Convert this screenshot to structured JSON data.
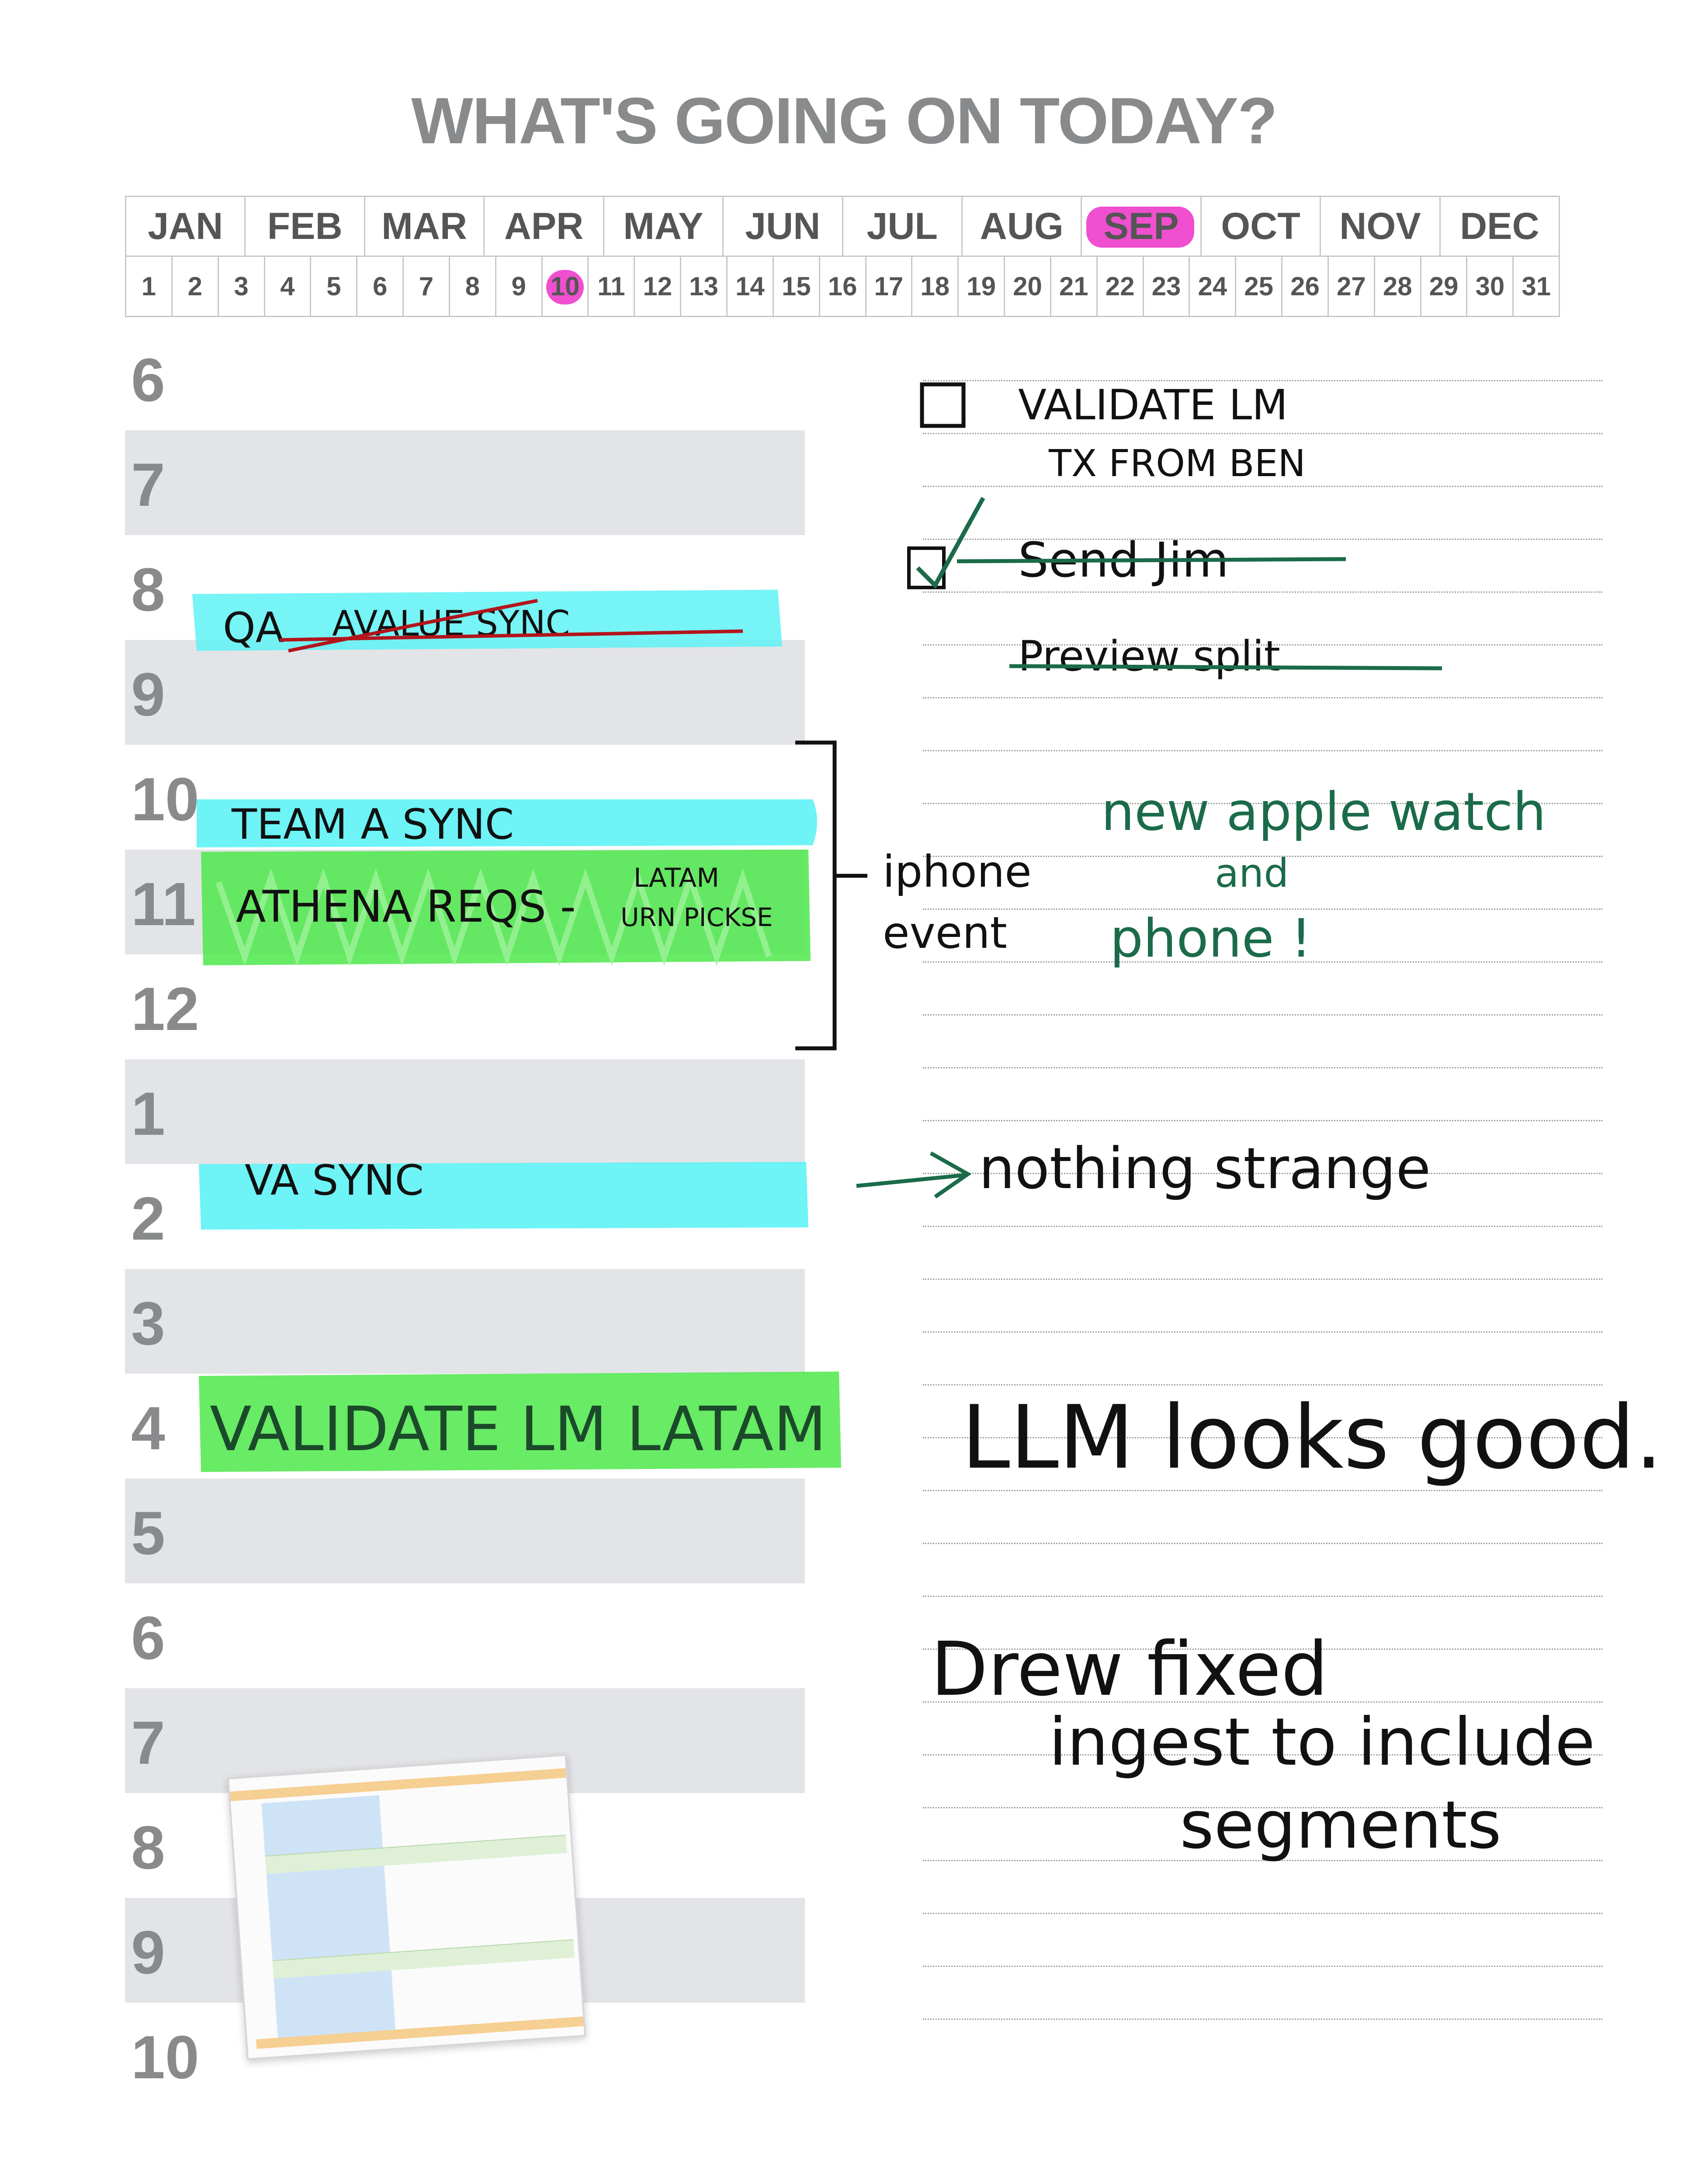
{
  "title": "WHAT'S GOING ON TODAY?",
  "months": [
    "JAN",
    "FEB",
    "MAR",
    "APR",
    "MAY",
    "JUN",
    "JUL",
    "AUG",
    "SEP",
    "OCT",
    "NOV",
    "DEC"
  ],
  "selected_month": "SEP",
  "days": [
    "1",
    "2",
    "3",
    "4",
    "5",
    "6",
    "7",
    "8",
    "9",
    "10",
    "11",
    "12",
    "13",
    "14",
    "15",
    "16",
    "17",
    "18",
    "19",
    "20",
    "21",
    "22",
    "23",
    "24",
    "25",
    "26",
    "27",
    "28",
    "29",
    "30",
    "31"
  ],
  "selected_day": "10",
  "hours": [
    "6",
    "7",
    "8",
    "9",
    "10",
    "11",
    "12",
    "1",
    "2",
    "3",
    "4",
    "5",
    "6",
    "7",
    "8",
    "9",
    "10"
  ],
  "colors": {
    "highlight_pink": "#f04fd0",
    "highlight_cyan": "#5ef2f5",
    "highlight_green": "#4ee84a",
    "ink_black": "#111111",
    "ink_green": "#1b6b4a",
    "ink_red": "#b3141c",
    "hour_band": "#e3e4e7"
  },
  "schedule": {
    "qa": {
      "text": "QA",
      "struck": "AVALUE SYNC"
    },
    "team_a": "TEAM A SYNC",
    "athena_a": "ATHENA REQS -",
    "athena_b": "LATAM",
    "athena_c": "URN PICKSE",
    "va_sync": "VA SYNC",
    "validate": "VALIDATE LM LATAM"
  },
  "notes": {
    "todo_1a": "VALIDATE LM",
    "todo_1b": "TX FROM BEN",
    "todo_2": "Send Jim",
    "todo_3": "Preview split",
    "iphone_a": "iphone",
    "iphone_b": "event",
    "apple_a": "new apple watch",
    "apple_b": "and",
    "apple_c": "phone !",
    "nothing": "nothing strange",
    "llm": "LLM looks good.",
    "drew_a": "Drew fixed",
    "drew_b": "ingest to include",
    "drew_c": "segments"
  }
}
